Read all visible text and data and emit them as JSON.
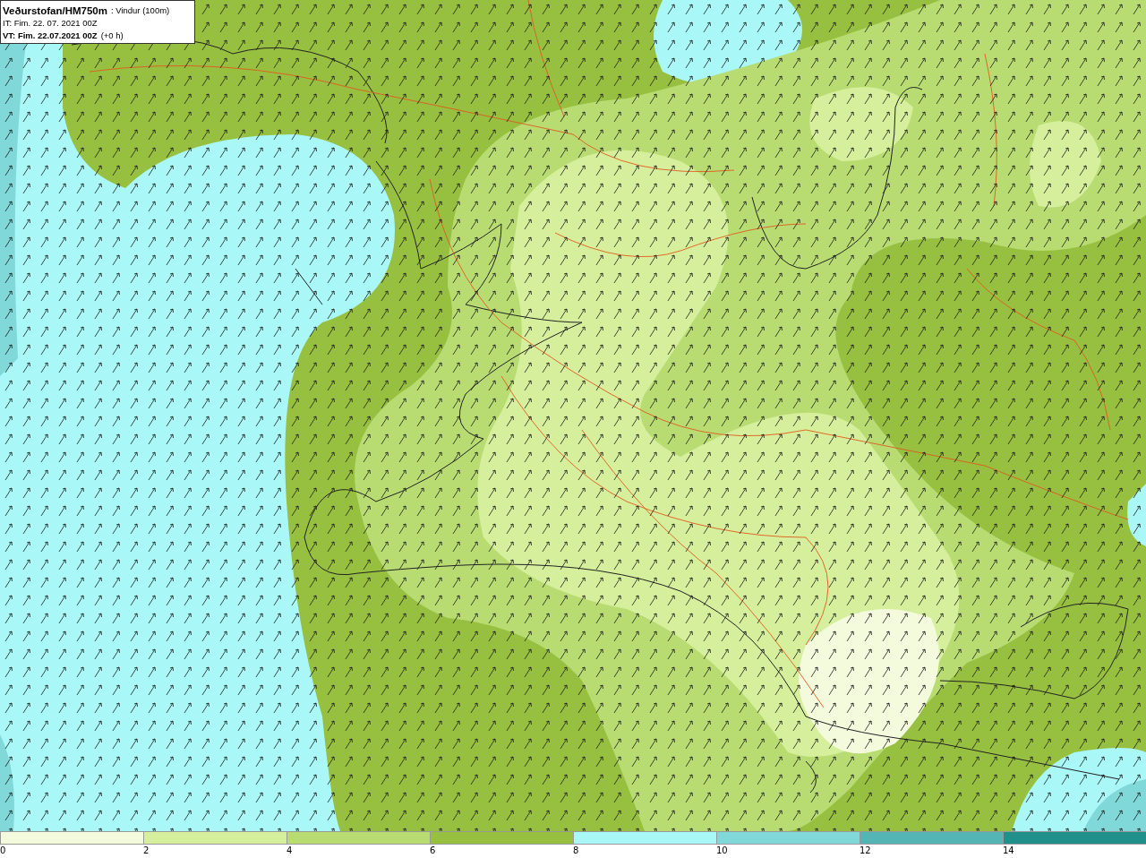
{
  "header": {
    "title": "Veðurstofan/HM750m",
    "field": ": Vindur (100m)",
    "issue_time": "IT: Fim. 22. 07. 2021 00Z",
    "valid_time": "VT: Fim. 22.07.2021 00Z",
    "lead": "(+0 h)"
  },
  "legend": [
    {
      "label": "0",
      "color": "#f3fbdc"
    },
    {
      "label": "2",
      "color": "#d6ef9c"
    },
    {
      "label": "4",
      "color": "#b8dc72"
    },
    {
      "label": "6",
      "color": "#97bf40"
    },
    {
      "label": "8",
      "color": "#aaf7f7"
    },
    {
      "label": "10",
      "color": "#80d8d8"
    },
    {
      "label": "12",
      "color": "#55b5b5"
    },
    {
      "label": "14",
      "color": "#22908a"
    }
  ]
}
